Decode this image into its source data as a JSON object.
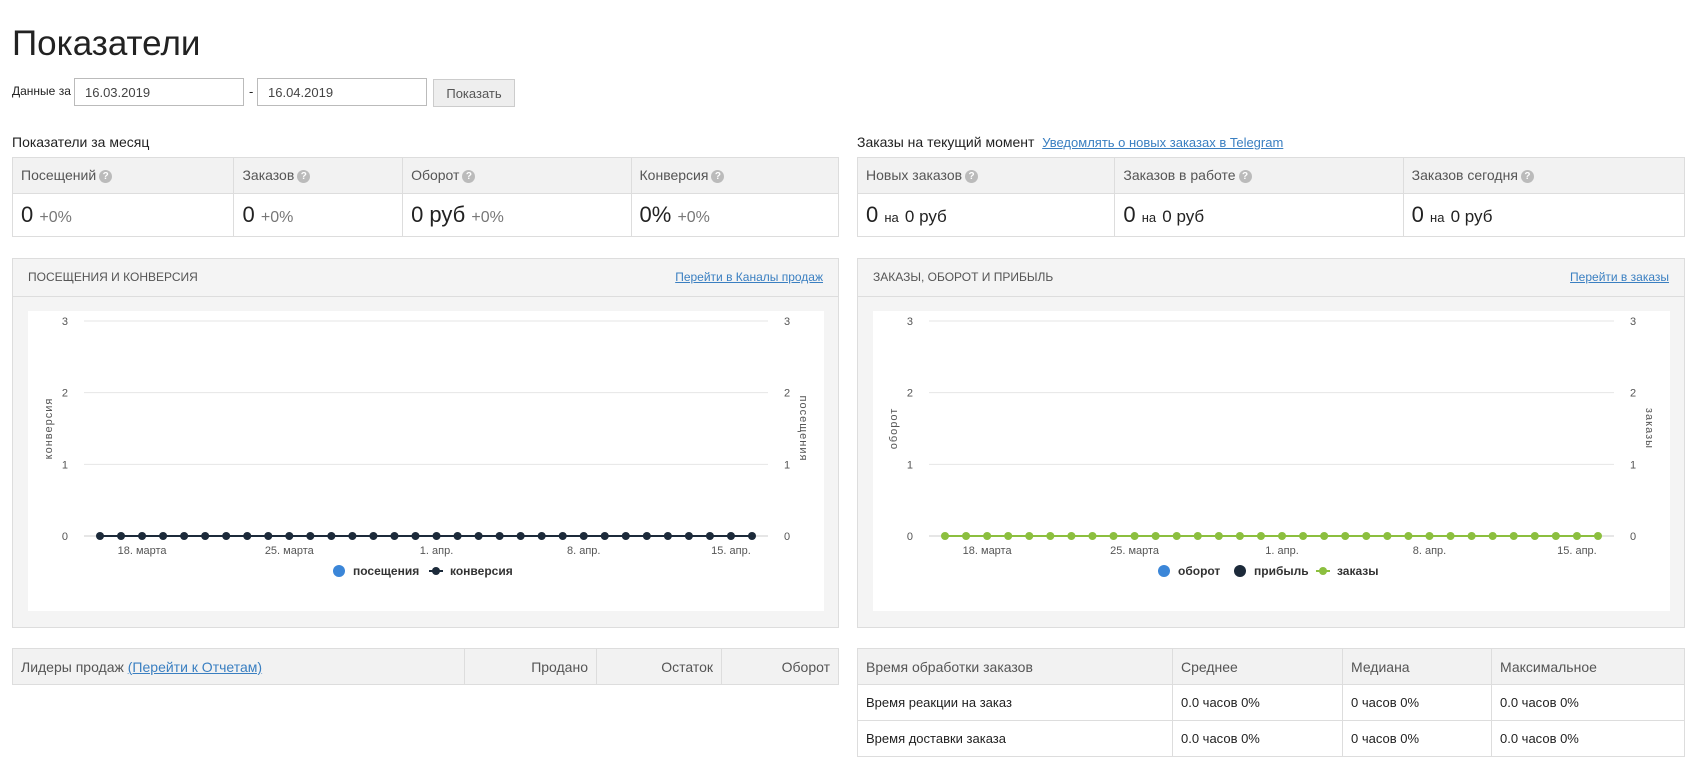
{
  "page": {
    "title": "Показатели"
  },
  "filter": {
    "label": "Данные за",
    "from": "16.03.2019",
    "separator": "-",
    "to": "16.04.2019",
    "show_label": "Показать"
  },
  "monthly": {
    "title": "Показатели за месяц",
    "items": [
      {
        "label": "Посещений",
        "value": "0",
        "change": "+0%"
      },
      {
        "label": "Заказов",
        "value": "0",
        "change": "+0%"
      },
      {
        "label": "Оборот",
        "value": "0 руб",
        "change": "+0%"
      },
      {
        "label": "Конверсия",
        "value": "0%",
        "change": "+0%"
      }
    ]
  },
  "current": {
    "title": "Заказы на текущий момент",
    "telegram_link": "Уведомлять о новых заказах в Telegram",
    "items": [
      {
        "label": "Новых заказов",
        "count": "0",
        "na": "на",
        "sum": "0 руб"
      },
      {
        "label": "Заказов в работе",
        "count": "0",
        "na": "на",
        "sum": "0 руб"
      },
      {
        "label": "Заказов сегодня",
        "count": "0",
        "na": "на",
        "sum": "0 руб"
      }
    ]
  },
  "help_icon": "question-circle-icon",
  "visits_panel": {
    "title": "ПОСЕЩЕНИЯ И КОНВЕРСИЯ",
    "link": "Перейти в Каналы продаж"
  },
  "orders_panel": {
    "title": "ЗАКАЗЫ, ОБОРОТ И ПРИБЫЛЬ",
    "link": "Перейти в заказы"
  },
  "chart_data": [
    {
      "type": "line",
      "x": [
        "16.03",
        "17.03",
        "18.03",
        "19.03",
        "20.03",
        "21.03",
        "22.03",
        "23.03",
        "24.03",
        "25.03",
        "26.03",
        "27.03",
        "28.03",
        "29.03",
        "30.03",
        "31.03",
        "01.04",
        "02.04",
        "03.04",
        "04.04",
        "05.04",
        "06.04",
        "07.04",
        "08.04",
        "09.04",
        "10.04",
        "11.04",
        "12.04",
        "13.04",
        "14.04",
        "15.04",
        "16.04"
      ],
      "tick_labels": [
        "18. марта",
        "25. марта",
        "1. апр.",
        "8. апр.",
        "15. апр."
      ],
      "y_ticks": [
        "0",
        "1",
        "2",
        "3"
      ],
      "ylim": [
        0,
        3
      ],
      "ylabel_left": "конверсия",
      "ylabel_right": "посещения",
      "series": [
        {
          "name": "посещения",
          "color": "#3b86d8",
          "values": []
        },
        {
          "name": "конверсия",
          "color": "#1c2a3a",
          "values": [
            0,
            0,
            0,
            0,
            0,
            0,
            0,
            0,
            0,
            0,
            0,
            0,
            0,
            0,
            0,
            0,
            0,
            0,
            0,
            0,
            0,
            0,
            0,
            0,
            0,
            0,
            0,
            0,
            0,
            0,
            0,
            0
          ]
        }
      ],
      "legend": "bottom"
    },
    {
      "type": "line",
      "x": [
        "16.03",
        "17.03",
        "18.03",
        "19.03",
        "20.03",
        "21.03",
        "22.03",
        "23.03",
        "24.03",
        "25.03",
        "26.03",
        "27.03",
        "28.03",
        "29.03",
        "30.03",
        "31.03",
        "01.04",
        "02.04",
        "03.04",
        "04.04",
        "05.04",
        "06.04",
        "07.04",
        "08.04",
        "09.04",
        "10.04",
        "11.04",
        "12.04",
        "13.04",
        "14.04",
        "15.04",
        "16.04"
      ],
      "tick_labels": [
        "18. марта",
        "25. марта",
        "1. апр.",
        "8. апр.",
        "15. апр."
      ],
      "y_ticks": [
        "0",
        "1",
        "2",
        "3"
      ],
      "ylim": [
        0,
        3
      ],
      "ylabel_left": "оборот",
      "ylabel_right": "заказы",
      "series": [
        {
          "name": "оборот",
          "color": "#3b86d8",
          "values": []
        },
        {
          "name": "прибыль",
          "color": "#1c2a3a",
          "values": []
        },
        {
          "name": "заказы",
          "color": "#8cbf3f",
          "values": [
            0,
            0,
            0,
            0,
            0,
            0,
            0,
            0,
            0,
            0,
            0,
            0,
            0,
            0,
            0,
            0,
            0,
            0,
            0,
            0,
            0,
            0,
            0,
            0,
            0,
            0,
            0,
            0,
            0,
            0,
            0,
            0
          ]
        }
      ],
      "legend": "bottom"
    }
  ],
  "leaders": {
    "title": "Лидеры продаж",
    "link": "(Перейти к Отчетам)",
    "columns": [
      "Продано",
      "Остаток",
      "Оборот"
    ]
  },
  "processing": {
    "columns": [
      "Время обработки заказов",
      "Среднее",
      "Медиана",
      "Максимальное"
    ],
    "rows": [
      [
        "Время реакции на заказ",
        "0.0 часов 0%",
        "0 часов 0%",
        "0.0 часов 0%"
      ],
      [
        "Время доставки заказа",
        "0.0 часов 0%",
        "0 часов 0%",
        "0.0 часов 0%"
      ]
    ]
  }
}
